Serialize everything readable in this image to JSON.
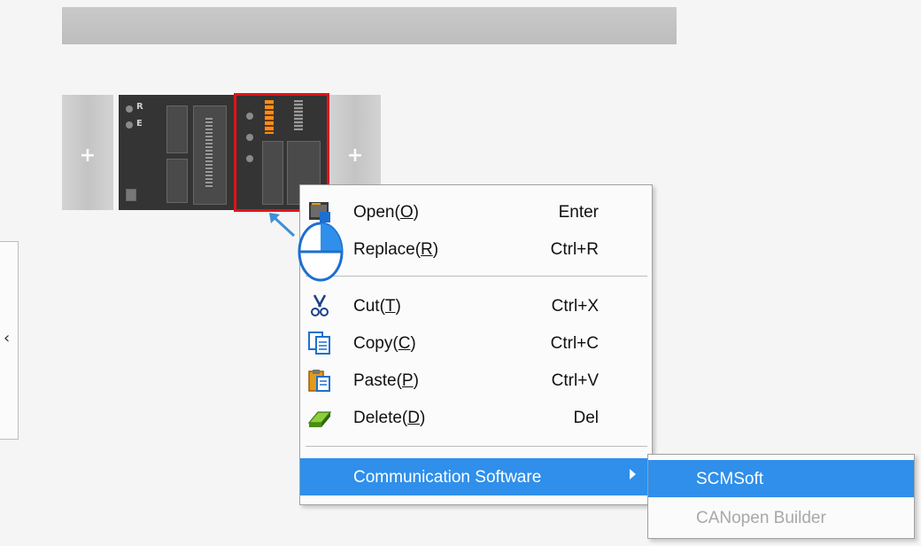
{
  "side_tab": {
    "chevron": "‹"
  },
  "rack": {
    "left_slot_plus": "+",
    "right_slot_plus": "+",
    "module1_labels": [
      "R",
      "E"
    ]
  },
  "context_menu": {
    "items": [
      {
        "label_pre": "Open(",
        "mnemonic": "O",
        "label_post": ")",
        "shortcut": "Enter",
        "icon": "open-icon"
      },
      {
        "label_pre": "Replace(",
        "mnemonic": "R",
        "label_post": ")",
        "shortcut": "Ctrl+R",
        "icon": "replace-icon"
      },
      {
        "label_pre": "Cut(",
        "mnemonic": "T",
        "label_post": ")",
        "shortcut": "Ctrl+X",
        "icon": "scissors-icon"
      },
      {
        "label_pre": "Copy(",
        "mnemonic": "C",
        "label_post": ")",
        "shortcut": "Ctrl+C",
        "icon": "copy-icon"
      },
      {
        "label_pre": "Paste(",
        "mnemonic": "P",
        "label_post": ")",
        "shortcut": "Ctrl+V",
        "icon": "paste-icon"
      },
      {
        "label_pre": "Delete(",
        "mnemonic": "D",
        "label_post": ")",
        "shortcut": "Del",
        "icon": "eraser-icon"
      }
    ],
    "communication_software": "Communication Software"
  },
  "submenu": {
    "items": [
      {
        "label": "SCMSoft",
        "state": "highlighted"
      },
      {
        "label": "CANopen Builder",
        "state": "disabled"
      }
    ]
  },
  "colors": {
    "highlight": "#2f8fea",
    "selection_outline": "#e0141b"
  }
}
